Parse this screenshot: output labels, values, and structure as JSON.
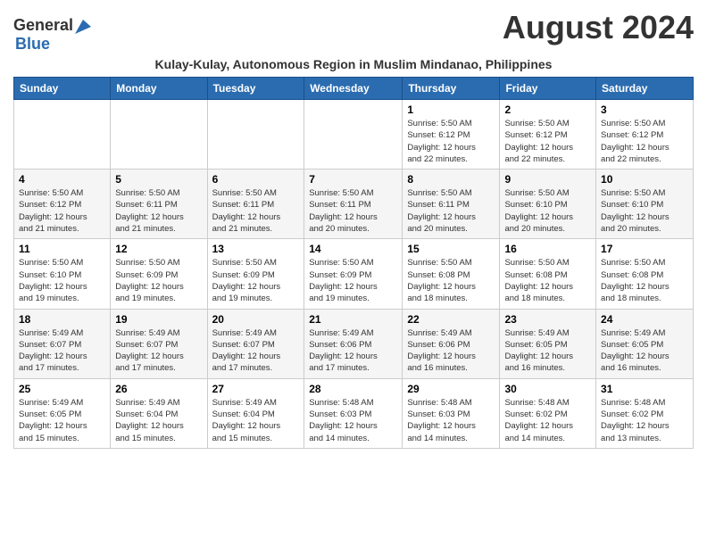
{
  "header": {
    "logo_general": "General",
    "logo_blue": "Blue",
    "month_title": "August 2024",
    "subtitle": "Kulay-Kulay, Autonomous Region in Muslim Mindanao, Philippines"
  },
  "days_of_week": [
    "Sunday",
    "Monday",
    "Tuesday",
    "Wednesday",
    "Thursday",
    "Friday",
    "Saturday"
  ],
  "weeks": [
    [
      {
        "num": "",
        "detail": ""
      },
      {
        "num": "",
        "detail": ""
      },
      {
        "num": "",
        "detail": ""
      },
      {
        "num": "",
        "detail": ""
      },
      {
        "num": "1",
        "detail": "Sunrise: 5:50 AM\nSunset: 6:12 PM\nDaylight: 12 hours\nand 22 minutes."
      },
      {
        "num": "2",
        "detail": "Sunrise: 5:50 AM\nSunset: 6:12 PM\nDaylight: 12 hours\nand 22 minutes."
      },
      {
        "num": "3",
        "detail": "Sunrise: 5:50 AM\nSunset: 6:12 PM\nDaylight: 12 hours\nand 22 minutes."
      }
    ],
    [
      {
        "num": "4",
        "detail": "Sunrise: 5:50 AM\nSunset: 6:12 PM\nDaylight: 12 hours\nand 21 minutes."
      },
      {
        "num": "5",
        "detail": "Sunrise: 5:50 AM\nSunset: 6:11 PM\nDaylight: 12 hours\nand 21 minutes."
      },
      {
        "num": "6",
        "detail": "Sunrise: 5:50 AM\nSunset: 6:11 PM\nDaylight: 12 hours\nand 21 minutes."
      },
      {
        "num": "7",
        "detail": "Sunrise: 5:50 AM\nSunset: 6:11 PM\nDaylight: 12 hours\nand 20 minutes."
      },
      {
        "num": "8",
        "detail": "Sunrise: 5:50 AM\nSunset: 6:11 PM\nDaylight: 12 hours\nand 20 minutes."
      },
      {
        "num": "9",
        "detail": "Sunrise: 5:50 AM\nSunset: 6:10 PM\nDaylight: 12 hours\nand 20 minutes."
      },
      {
        "num": "10",
        "detail": "Sunrise: 5:50 AM\nSunset: 6:10 PM\nDaylight: 12 hours\nand 20 minutes."
      }
    ],
    [
      {
        "num": "11",
        "detail": "Sunrise: 5:50 AM\nSunset: 6:10 PM\nDaylight: 12 hours\nand 19 minutes."
      },
      {
        "num": "12",
        "detail": "Sunrise: 5:50 AM\nSunset: 6:09 PM\nDaylight: 12 hours\nand 19 minutes."
      },
      {
        "num": "13",
        "detail": "Sunrise: 5:50 AM\nSunset: 6:09 PM\nDaylight: 12 hours\nand 19 minutes."
      },
      {
        "num": "14",
        "detail": "Sunrise: 5:50 AM\nSunset: 6:09 PM\nDaylight: 12 hours\nand 19 minutes."
      },
      {
        "num": "15",
        "detail": "Sunrise: 5:50 AM\nSunset: 6:08 PM\nDaylight: 12 hours\nand 18 minutes."
      },
      {
        "num": "16",
        "detail": "Sunrise: 5:50 AM\nSunset: 6:08 PM\nDaylight: 12 hours\nand 18 minutes."
      },
      {
        "num": "17",
        "detail": "Sunrise: 5:50 AM\nSunset: 6:08 PM\nDaylight: 12 hours\nand 18 minutes."
      }
    ],
    [
      {
        "num": "18",
        "detail": "Sunrise: 5:49 AM\nSunset: 6:07 PM\nDaylight: 12 hours\nand 17 minutes."
      },
      {
        "num": "19",
        "detail": "Sunrise: 5:49 AM\nSunset: 6:07 PM\nDaylight: 12 hours\nand 17 minutes."
      },
      {
        "num": "20",
        "detail": "Sunrise: 5:49 AM\nSunset: 6:07 PM\nDaylight: 12 hours\nand 17 minutes."
      },
      {
        "num": "21",
        "detail": "Sunrise: 5:49 AM\nSunset: 6:06 PM\nDaylight: 12 hours\nand 17 minutes."
      },
      {
        "num": "22",
        "detail": "Sunrise: 5:49 AM\nSunset: 6:06 PM\nDaylight: 12 hours\nand 16 minutes."
      },
      {
        "num": "23",
        "detail": "Sunrise: 5:49 AM\nSunset: 6:05 PM\nDaylight: 12 hours\nand 16 minutes."
      },
      {
        "num": "24",
        "detail": "Sunrise: 5:49 AM\nSunset: 6:05 PM\nDaylight: 12 hours\nand 16 minutes."
      }
    ],
    [
      {
        "num": "25",
        "detail": "Sunrise: 5:49 AM\nSunset: 6:05 PM\nDaylight: 12 hours\nand 15 minutes."
      },
      {
        "num": "26",
        "detail": "Sunrise: 5:49 AM\nSunset: 6:04 PM\nDaylight: 12 hours\nand 15 minutes."
      },
      {
        "num": "27",
        "detail": "Sunrise: 5:49 AM\nSunset: 6:04 PM\nDaylight: 12 hours\nand 15 minutes."
      },
      {
        "num": "28",
        "detail": "Sunrise: 5:48 AM\nSunset: 6:03 PM\nDaylight: 12 hours\nand 14 minutes."
      },
      {
        "num": "29",
        "detail": "Sunrise: 5:48 AM\nSunset: 6:03 PM\nDaylight: 12 hours\nand 14 minutes."
      },
      {
        "num": "30",
        "detail": "Sunrise: 5:48 AM\nSunset: 6:02 PM\nDaylight: 12 hours\nand 14 minutes."
      },
      {
        "num": "31",
        "detail": "Sunrise: 5:48 AM\nSunset: 6:02 PM\nDaylight: 12 hours\nand 13 minutes."
      }
    ]
  ]
}
